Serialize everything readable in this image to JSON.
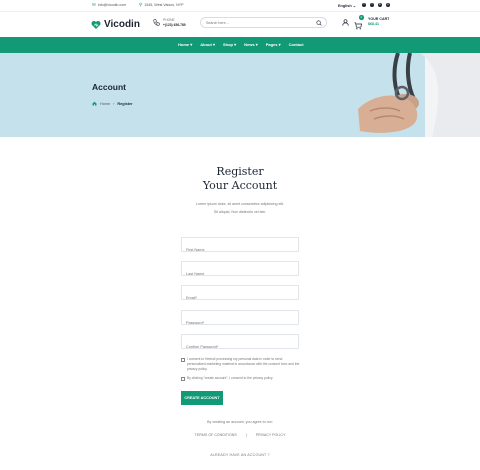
{
  "topbar": {
    "email": "info@vicodin.com",
    "location": "1545, West Vaison, NYP",
    "language": "English",
    "socials": [
      "f",
      "t",
      "in",
      "p"
    ]
  },
  "header": {
    "logo_text": "Vicodin",
    "phone_label": "PHONE",
    "phone_number": "+(123) 456-789",
    "search_placeholder": "Search here...",
    "cart_label": "YOUR CART",
    "cart_total": "$68.41",
    "cart_count": "2"
  },
  "nav": {
    "items": [
      "Home",
      "About",
      "Shop",
      "News",
      "Pages",
      "Contact"
    ]
  },
  "hero": {
    "title": "Account",
    "breadcrumb_home": "Home",
    "breadcrumb_current": "Register"
  },
  "register": {
    "title_line1": "Register",
    "title_line2": "Your Account",
    "subtitle_line1": "Lorem ipsum dolor, sit amet consectetur adipisicing elit.",
    "subtitle_line2": "Sit aliquid, Non distinctio vel iste.",
    "fields": {
      "first_name": "First Name",
      "last_name": "Last Name",
      "email": "Email*",
      "password": "Password*",
      "confirm_password": "Confirm Password*"
    },
    "consent_text": "I consent to Herboil processing my personal data in order to send personalized marketing material in accordance with the consent form and the privacy policy.",
    "privacy_text": "By clicking \"create account\", I consent to the privacy policy.",
    "create_button": "CREATE ACCOUNT",
    "agree_text": "By creating an account, you agree to our:",
    "terms_link": "TERMS OF CONDITIONS",
    "separator": "|",
    "privacy_link": "PRIVACY POLICY",
    "already_text": "ALREADY HAVE AN ACCOUNT ?"
  },
  "colors": {
    "brand": "#119a75",
    "hero_bg": "#c5e2ec",
    "text_dark": "#1d2433"
  }
}
